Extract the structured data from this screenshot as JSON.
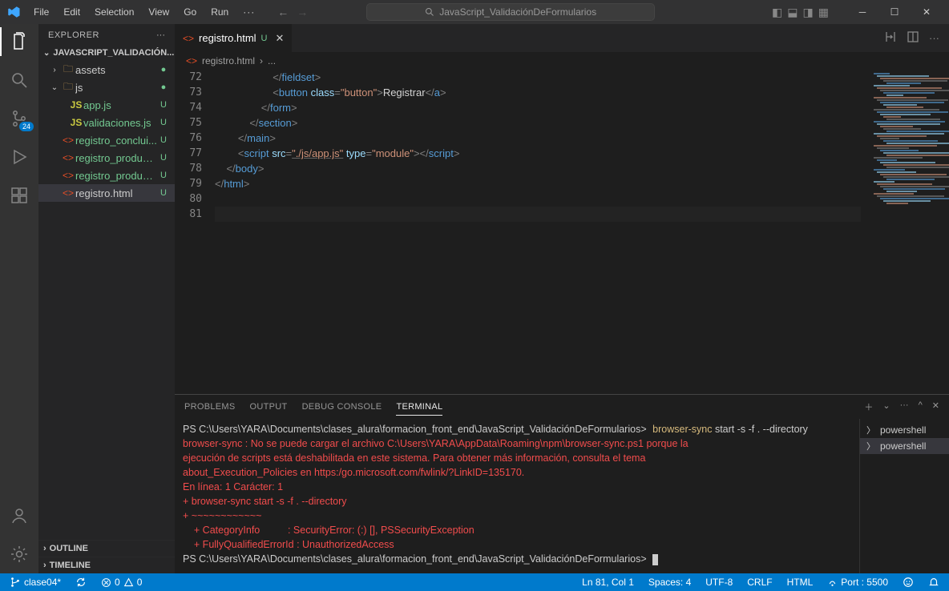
{
  "menu": {
    "file": "File",
    "edit": "Edit",
    "selection": "Selection",
    "view": "View",
    "go": "Go",
    "run": "Run",
    "more": "···"
  },
  "search_placeholder": "JavaScript_ValidaciónDeFormularios",
  "activity": {
    "scm_badge": "24"
  },
  "sidebar": {
    "title": "EXPLORER",
    "section": "JAVASCRIPT_VALIDACIÓN...",
    "items": [
      {
        "type": "folder",
        "label": "assets",
        "indent": 1,
        "open": false,
        "mark": "●",
        "markc": "m-green"
      },
      {
        "type": "folder",
        "label": "js",
        "indent": 1,
        "open": true,
        "mark": "●",
        "markc": "m-green"
      },
      {
        "type": "js",
        "label": "app.js",
        "indent": 2,
        "mark": "U",
        "markc": "m-u",
        "lblc": "m-green"
      },
      {
        "type": "js",
        "label": "validaciones.js",
        "indent": 2,
        "mark": "U",
        "markc": "m-u",
        "lblc": "m-green"
      },
      {
        "type": "html",
        "label": "registro_conclui...",
        "indent": 1,
        "mark": "U",
        "markc": "m-u",
        "lblc": "m-green"
      },
      {
        "type": "html",
        "label": "registro_product...",
        "indent": 1,
        "mark": "U",
        "markc": "m-u",
        "lblc": "m-green"
      },
      {
        "type": "html",
        "label": "registro_product...",
        "indent": 1,
        "mark": "U",
        "markc": "m-u",
        "lblc": "m-green"
      },
      {
        "type": "html",
        "label": "registro.html",
        "indent": 1,
        "mark": "U",
        "markc": "m-u",
        "selected": true
      }
    ],
    "outline": "OUTLINE",
    "timeline": "TIMELINE"
  },
  "tab": {
    "label": "registro.html",
    "state": "U"
  },
  "breadcrumb": {
    "file": "registro.html",
    "more": "..."
  },
  "code": {
    "start": 72,
    "lines": [
      {
        "html": "                    <span class='tk-pun'>&lt;/</span><span class='tk-tag'>fieldset</span><span class='tk-pun'>&gt;</span>"
      },
      {
        "html": "                    <span class='tk-pun'>&lt;</span><span class='tk-tag'>button</span> <span class='tk-attr'>class</span><span class='tk-pun'>=</span><span class='tk-str'>\"button\"</span><span class='tk-pun'>&gt;</span><span class='tk-text'>Registrar</span><span class='tk-pun'>&lt;/</span><span class='tk-tag'>a</span><span class='tk-pun'>&gt;</span>"
      },
      {
        "html": "                <span class='tk-pun'>&lt;/</span><span class='tk-tag'>form</span><span class='tk-pun'>&gt;</span>"
      },
      {
        "html": "            <span class='tk-pun'>&lt;/</span><span class='tk-tag'>section</span><span class='tk-pun'>&gt;</span>"
      },
      {
        "html": "        <span class='tk-pun'>&lt;/</span><span class='tk-tag'>main</span><span class='tk-pun'>&gt;</span>"
      },
      {
        "html": "        <span class='tk-pun'>&lt;</span><span class='tk-tag'>script</span> <span class='tk-attr'>src</span><span class='tk-pun'>=</span><span class='tk-link'>\"./js/app.js\"</span> <span class='tk-attr'>type</span><span class='tk-pun'>=</span><span class='tk-str'>\"module\"</span><span class='tk-pun'>&gt;&lt;/</span><span class='tk-tag'>script</span><span class='tk-pun'>&gt;</span>"
      },
      {
        "html": "    <span class='tk-pun'>&lt;/</span><span class='tk-tag'>body</span><span class='tk-pun'>&gt;</span>"
      },
      {
        "html": "<span class='tk-pun'>&lt;/</span><span class='tk-tag'>html</span><span class='tk-pun'>&gt;</span>"
      },
      {
        "html": ""
      },
      {
        "html": "",
        "cursor": true
      }
    ]
  },
  "panel": {
    "tabs": {
      "problems": "PROBLEMS",
      "output": "OUTPUT",
      "debug": "DEBUG CONSOLE",
      "terminal": "TERMINAL"
    },
    "prompt": "PS C:\\Users\\YARA\\Documents\\clases_alura\\formacion_front_end\\JavaScript_ValidaciónDeFormularios>",
    "cmd1": "browser-sync",
    "cmd2": " start -s -f . --directory",
    "err1": "browser-sync : No se puede cargar el archivo C:\\Users\\YARA\\AppData\\Roaming\\npm\\browser-sync.ps1 porque la ",
    "err2": "ejecución de scripts está deshabilitada en este sistema. Para obtener más información, consulta el tema ",
    "err3": "about_Execution_Policies en https:/go.microsoft.com/fwlink/?LinkID=135170.",
    "err4": "En línea: 1 Carácter: 1",
    "err5": "+ browser-sync start -s -f . --directory",
    "err6": "+ ~~~~~~~~~~~~",
    "err7": "    + CategoryInfo          : SecurityError: (:) [], PSSecurityException",
    "err8": "    + FullyQualifiedErrorId : UnauthorizedAccess",
    "side": [
      {
        "label": "powershell"
      },
      {
        "label": "powershell",
        "active": true
      }
    ]
  },
  "status": {
    "branch": "clase04*",
    "errors": "0",
    "warnings": "0",
    "ln": "Ln 81, Col 1",
    "spaces": "Spaces: 4",
    "enc": "UTF-8",
    "eol": "CRLF",
    "lang": "HTML",
    "port": "Port : 5500"
  }
}
